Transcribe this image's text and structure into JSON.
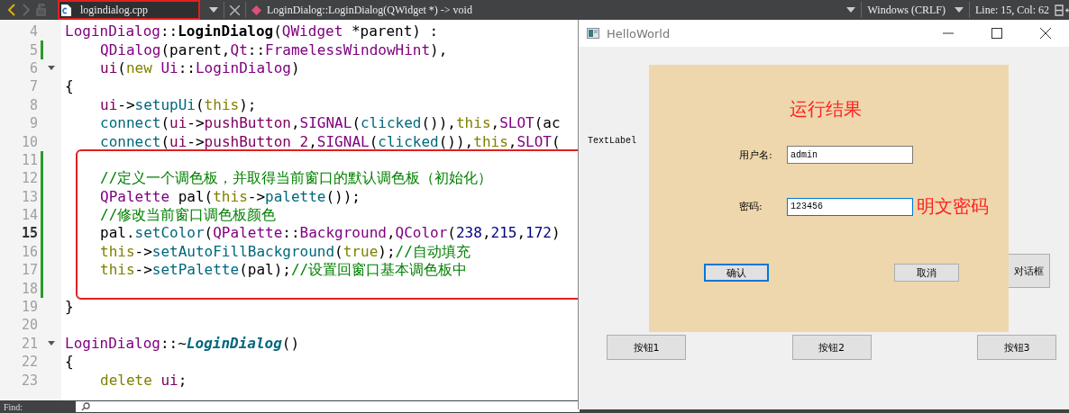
{
  "toolbar": {
    "file_tab": {
      "label": "logindialog.cpp",
      "highlighted": true
    },
    "symbol": "LoginDialog::LoginDialog(QWidget *) -> void",
    "line_ending": "Windows (CRLF)",
    "position": "Line: 15, Col: 62"
  },
  "code": {
    "blocks": [
      {
        "highlighted": false,
        "lines": [
          {
            "number": "4",
            "current": false,
            "modified": false,
            "foldable": false,
            "indented": false,
            "tokens": [
              {
                "t": "LoginDialog",
                "kind": "type"
              },
              {
                "t": "::",
                "kind": "plain"
              },
              {
                "t": "LoginDialog",
                "kind": "decl"
              },
              {
                "t": "(",
                "kind": "plain"
              },
              {
                "t": "QWidget",
                "kind": "type"
              },
              {
                "t": " *parent) :",
                "kind": "plain"
              }
            ]
          },
          {
            "number": "5",
            "current": false,
            "modified": true,
            "foldable": false,
            "indented": true,
            "tokens": [
              {
                "t": "QDialog",
                "kind": "type"
              },
              {
                "t": "(parent,",
                "kind": "plain"
              },
              {
                "t": "Qt",
                "kind": "type"
              },
              {
                "t": "::",
                "kind": "plain"
              },
              {
                "t": "FramelessWindowHint",
                "kind": "type"
              },
              {
                "t": "),",
                "kind": "plain"
              }
            ]
          },
          {
            "number": "6",
            "current": false,
            "modified": false,
            "foldable": true,
            "indented": true,
            "tokens": [
              {
                "t": "ui",
                "kind": "field"
              },
              {
                "t": "(",
                "kind": "plain"
              },
              {
                "t": "new",
                "kind": "kw"
              },
              {
                "t": " Ui",
                "kind": "type"
              },
              {
                "t": "::",
                "kind": "plain"
              },
              {
                "t": "LoginDialog",
                "kind": "type"
              },
              {
                "t": ")",
                "kind": "plain"
              }
            ]
          },
          {
            "number": "7",
            "current": false,
            "modified": false,
            "foldable": false,
            "indented": false,
            "tokens": [
              {
                "t": "{",
                "kind": "plain"
              }
            ]
          },
          {
            "number": "8",
            "current": false,
            "modified": false,
            "foldable": false,
            "indented": true,
            "tokens": [
              {
                "t": "ui",
                "kind": "field"
              },
              {
                "t": "->",
                "kind": "plain"
              },
              {
                "t": "setupUi",
                "kind": "func"
              },
              {
                "t": "(",
                "kind": "plain"
              },
              {
                "t": "this",
                "kind": "kw"
              },
              {
                "t": ");",
                "kind": "plain"
              }
            ]
          },
          {
            "number": "9",
            "current": false,
            "modified": false,
            "foldable": false,
            "indented": true,
            "tokens": [
              {
                "t": "connect",
                "kind": "func"
              },
              {
                "t": "(",
                "kind": "plain"
              },
              {
                "t": "ui",
                "kind": "field"
              },
              {
                "t": "->",
                "kind": "plain"
              },
              {
                "t": "pushButton",
                "kind": "field"
              },
              {
                "t": ",",
                "kind": "plain"
              },
              {
                "t": "SIGNAL",
                "kind": "type"
              },
              {
                "t": "(",
                "kind": "plain"
              },
              {
                "t": "clicked",
                "kind": "func"
              },
              {
                "t": "()),",
                "kind": "plain"
              },
              {
                "t": "this",
                "kind": "kw"
              },
              {
                "t": ",",
                "kind": "plain"
              },
              {
                "t": "SLOT",
                "kind": "type"
              },
              {
                "t": "(ac",
                "kind": "plain"
              }
            ]
          },
          {
            "number": "10",
            "current": false,
            "modified": false,
            "foldable": false,
            "indented": true,
            "tokens": [
              {
                "t": "connect",
                "kind": "func"
              },
              {
                "t": "(",
                "kind": "plain"
              },
              {
                "t": "ui",
                "kind": "field"
              },
              {
                "t": "->",
                "kind": "plain"
              },
              {
                "t": "pushButton_2",
                "kind": "field"
              },
              {
                "t": ",",
                "kind": "plain"
              },
              {
                "t": "SIGNAL",
                "kind": "type"
              },
              {
                "t": "(",
                "kind": "plain"
              },
              {
                "t": "clicked",
                "kind": "func"
              },
              {
                "t": "()),",
                "kind": "plain"
              },
              {
                "t": "this",
                "kind": "kw"
              },
              {
                "t": ",",
                "kind": "plain"
              },
              {
                "t": "SLOT",
                "kind": "type"
              },
              {
                "t": "(",
                "kind": "plain"
              }
            ]
          }
        ]
      },
      {
        "highlighted": true,
        "lines": [
          {
            "number": "11",
            "current": false,
            "modified": true,
            "foldable": false
          },
          {
            "number": "12",
            "current": false,
            "modified": true,
            "foldable": false,
            "indented": true,
            "tokens": [
              {
                "t": "//定义一个调色板，并取得当前窗口的默认调色板（初始化）",
                "kind": "com"
              }
            ]
          },
          {
            "number": "13",
            "current": false,
            "modified": true,
            "foldable": false,
            "indented": true,
            "tokens": [
              {
                "t": "QPalette",
                "kind": "type"
              },
              {
                "t": " pal(",
                "kind": "plain"
              },
              {
                "t": "this",
                "kind": "kw"
              },
              {
                "t": "->",
                "kind": "plain"
              },
              {
                "t": "palette",
                "kind": "func"
              },
              {
                "t": "());",
                "kind": "plain"
              }
            ]
          },
          {
            "number": "14",
            "current": false,
            "modified": true,
            "foldable": false,
            "indented": true,
            "tokens": [
              {
                "t": "//修改当前窗口调色板颜色",
                "kind": "com"
              }
            ]
          },
          {
            "number": "15",
            "current": true,
            "modified": true,
            "foldable": false,
            "indented": true,
            "tokens": [
              {
                "t": "pal.",
                "kind": "plain"
              },
              {
                "t": "setColor",
                "kind": "func"
              },
              {
                "t": "(",
                "kind": "plain"
              },
              {
                "t": "QPalette",
                "kind": "type"
              },
              {
                "t": "::",
                "kind": "plain"
              },
              {
                "t": "Background",
                "kind": "type"
              },
              {
                "t": ",",
                "kind": "plain"
              },
              {
                "t": "QColor",
                "kind": "type"
              },
              {
                "t": "(",
                "kind": "plain"
              },
              {
                "t": "238",
                "kind": "num"
              },
              {
                "t": ",",
                "kind": "plain"
              },
              {
                "t": "215",
                "kind": "num"
              },
              {
                "t": ",",
                "kind": "plain"
              },
              {
                "t": "172",
                "kind": "num"
              },
              {
                "t": ")",
                "kind": "plain"
              }
            ]
          },
          {
            "number": "16",
            "current": false,
            "modified": true,
            "foldable": false,
            "indented": true,
            "tokens": [
              {
                "t": "this",
                "kind": "kw"
              },
              {
                "t": "->",
                "kind": "plain"
              },
              {
                "t": "setAutoFillBackground",
                "kind": "func"
              },
              {
                "t": "(",
                "kind": "plain"
              },
              {
                "t": "true",
                "kind": "kw"
              },
              {
                "t": ");",
                "kind": "plain"
              },
              {
                "t": "//自动填充",
                "kind": "com"
              }
            ]
          },
          {
            "number": "17",
            "current": false,
            "modified": true,
            "foldable": false,
            "indented": true,
            "tokens": [
              {
                "t": "this",
                "kind": "kw"
              },
              {
                "t": "->",
                "kind": "plain"
              },
              {
                "t": "setPalette",
                "kind": "func"
              },
              {
                "t": "(pal);",
                "kind": "plain"
              },
              {
                "t": "//设置回窗口基本调色板中",
                "kind": "com"
              }
            ]
          },
          {
            "number": "18",
            "current": false,
            "modified": true,
            "foldable": false
          }
        ]
      },
      {
        "highlighted": false,
        "lines": [
          {
            "number": "19",
            "current": false,
            "modified": false,
            "foldable": false,
            "indented": false,
            "tokens": [
              {
                "t": "}",
                "kind": "plain"
              }
            ]
          },
          {
            "number": "20",
            "current": false,
            "modified": false,
            "foldable": false
          },
          {
            "number": "21",
            "current": false,
            "modified": false,
            "foldable": true,
            "indented": false,
            "tokens": [
              {
                "t": "LoginDialog",
                "kind": "type"
              },
              {
                "t": "::~",
                "kind": "plain"
              },
              {
                "t": "LoginDialog",
                "kind": "dtor"
              },
              {
                "t": "()",
                "kind": "plain"
              }
            ]
          },
          {
            "number": "22",
            "current": false,
            "modified": false,
            "foldable": false,
            "indented": false,
            "tokens": [
              {
                "t": "{",
                "kind": "plain"
              }
            ]
          },
          {
            "number": "23",
            "current": false,
            "modified": false,
            "foldable": false,
            "indented": true,
            "tokens": [
              {
                "t": "delete",
                "kind": "kw"
              },
              {
                "t": " ui",
                "kind": "field"
              },
              {
                "t": ";",
                "kind": "plain"
              }
            ]
          }
        ]
      }
    ]
  },
  "find_bar": {
    "label": "Find:"
  },
  "window": {
    "title": "HelloWorld",
    "text_label": "TextLabel",
    "panel": {
      "heading": "运行结果",
      "fields": [
        {
          "label": "用户名:",
          "value": "admin",
          "focused": false
        },
        {
          "label": "密码:",
          "value": "123456",
          "focused": true,
          "note": "明文密码"
        }
      ],
      "buttons": [
        {
          "label": "确认",
          "focused": true
        },
        {
          "label": "取消",
          "focused": false
        }
      ]
    },
    "side_button": {
      "label": "对话框"
    },
    "buttons": [
      "按钮1",
      "按钮2",
      "按钮3"
    ]
  }
}
